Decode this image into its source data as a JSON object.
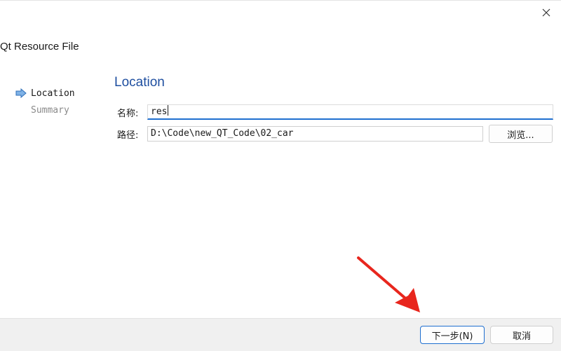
{
  "window": {
    "close_icon": "close-icon",
    "wizard_title": "Qt Resource File"
  },
  "steps": [
    {
      "label": "Location",
      "state": "current",
      "icon": "arrow-right-icon"
    },
    {
      "label": "Summary",
      "state": "pending"
    }
  ],
  "page": {
    "title": "Location",
    "name_label": "名称:",
    "name_value": "res",
    "path_label": "路径:",
    "path_value": "D:\\Code\\new_QT_Code\\02_car",
    "browse_label": "浏览..."
  },
  "footer": {
    "next_label": "下一步(N)",
    "cancel_label": "取消"
  },
  "colors": {
    "accent": "#1f6fd0",
    "title_blue": "#1f4fa0",
    "annotation_arrow": "#e8261d"
  }
}
